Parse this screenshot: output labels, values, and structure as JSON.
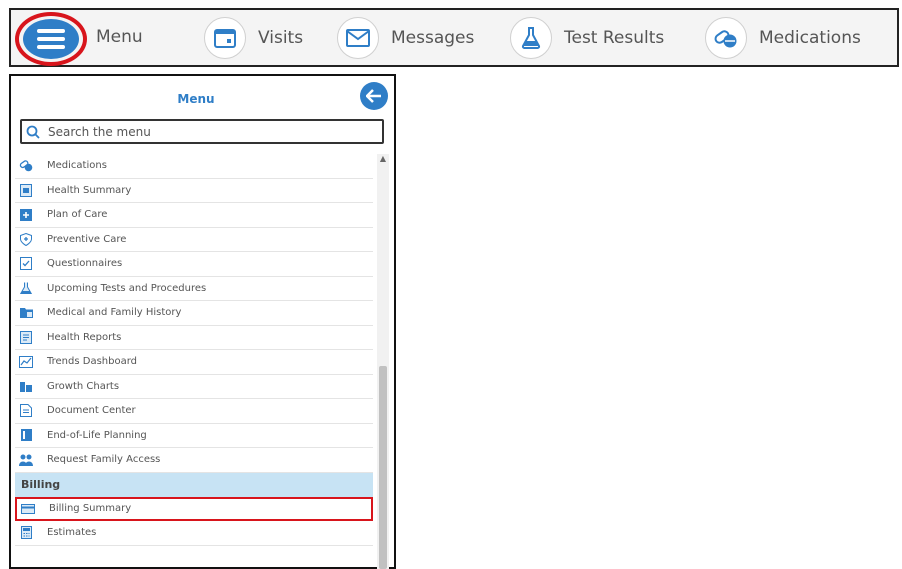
{
  "topbar": {
    "menu_label": "Menu",
    "nav": [
      {
        "label": "Visits",
        "icon": "calendar-icon"
      },
      {
        "label": "Messages",
        "icon": "envelope-icon"
      },
      {
        "label": "Test Results",
        "icon": "flask-icon"
      },
      {
        "label": "Medications",
        "icon": "pills-icon"
      }
    ]
  },
  "panel": {
    "title": "Menu",
    "search_placeholder": "Search the menu",
    "items": [
      {
        "label": "Medications",
        "icon": "pills-icon"
      },
      {
        "label": "Health Summary",
        "icon": "clipboard-icon"
      },
      {
        "label": "Plan of Care",
        "icon": "plus-square-icon"
      },
      {
        "label": "Preventive Care",
        "icon": "shield-icon"
      },
      {
        "label": "Questionnaires",
        "icon": "checklist-icon"
      },
      {
        "label": "Upcoming Tests and Procedures",
        "icon": "flask-icon"
      },
      {
        "label": "Medical and Family History",
        "icon": "folder-icon"
      },
      {
        "label": "Health Reports",
        "icon": "report-icon"
      },
      {
        "label": "Trends Dashboard",
        "icon": "chart-icon"
      },
      {
        "label": "Growth Charts",
        "icon": "bar-chart-icon"
      },
      {
        "label": "Document Center",
        "icon": "document-icon"
      },
      {
        "label": "End-of-Life Planning",
        "icon": "book-icon"
      },
      {
        "label": "Request Family Access",
        "icon": "family-icon"
      }
    ],
    "section_billing": "Billing",
    "billing_items": [
      {
        "label": "Billing Summary",
        "icon": "credit-card-icon"
      },
      {
        "label": "Estimates",
        "icon": "calculator-icon"
      }
    ]
  },
  "colors": {
    "accent": "#2f7ec7",
    "highlight": "#d8151c",
    "section_bg": "#c7e3f4"
  }
}
